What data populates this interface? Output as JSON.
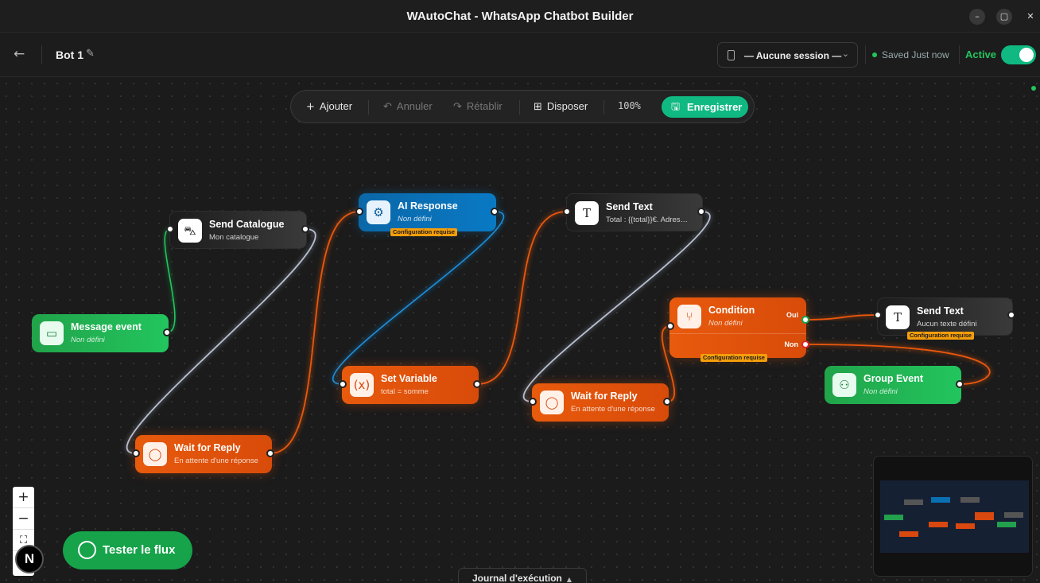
{
  "window": {
    "title": "WAutoChat - WhatsApp Chatbot Builder"
  },
  "header": {
    "bot_name": "Bot 1",
    "session_select": "— Aucune session —",
    "saved_status": "Saved Just now",
    "active_label": "Active",
    "active_toggle": true
  },
  "toolbar": {
    "add": "Ajouter",
    "undo": "Annuler",
    "redo": "Rétablir",
    "arrange": "Disposer",
    "zoom": "100%",
    "save": "Enregistrer"
  },
  "nodes": {
    "message_event": {
      "title": "Message event",
      "subtitle": "Non défini"
    },
    "send_catalogue": {
      "title": "Send Catalogue",
      "subtitle": "Mon catalogue"
    },
    "wait_reply_1": {
      "title": "Wait for Reply",
      "subtitle": "En attente d'une réponse"
    },
    "ai_response": {
      "title": "AI Response",
      "subtitle": "Non défini",
      "badge": "Configuration requise"
    },
    "set_variable": {
      "title": "Set Variable",
      "subtitle": "total = somme"
    },
    "send_text_1": {
      "title": "Send Text",
      "subtitle": "Total : {{total}}€. Adres…"
    },
    "wait_reply_2": {
      "title": "Wait for Reply",
      "subtitle": "En attente d'une réponse"
    },
    "condition": {
      "title": "Condition",
      "subtitle": "Non défini",
      "badge": "Configuration requise",
      "yes": "Oui",
      "no": "Non"
    },
    "send_text_2": {
      "title": "Send Text",
      "subtitle": "Aucun texte défini",
      "badge": "Configuration requise"
    },
    "group_event": {
      "title": "Group Event",
      "subtitle": "Non défini"
    }
  },
  "bottom": {
    "test_flow": "Tester le flux",
    "journal": "Journal d'exécution",
    "logo_letter": "N"
  },
  "colors": {
    "accent_green": "#10b981",
    "node_orange": "#e85a0c",
    "node_blue": "#0979c4",
    "badge_amber": "#f59e0b"
  }
}
